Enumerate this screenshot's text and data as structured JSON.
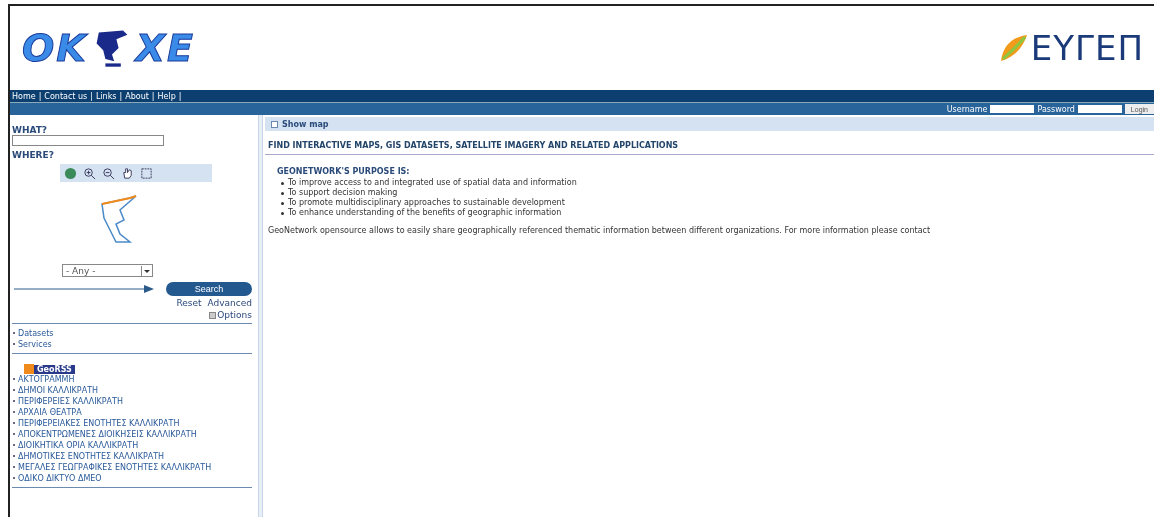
{
  "header": {
    "logo_left": [
      "OK",
      "XE"
    ],
    "logo_right": "ΕΥΓΕΠ"
  },
  "nav": {
    "links": [
      "Home",
      "Contact us",
      "Links",
      "About",
      "Help"
    ],
    "separator": "|"
  },
  "login": {
    "username_label": "Username",
    "password_label": "Password",
    "button": "Login"
  },
  "sidebar": {
    "what_label": "WHAT?",
    "where_label": "WHERE?",
    "region_select": "- Any -",
    "search_button": "Search",
    "reset": "Reset",
    "advanced": "Advanced",
    "options": "Options",
    "types": [
      "Datasets",
      "Services"
    ],
    "georss": "GeoRSS",
    "layers": [
      "ΑΚΤΟΓΡΑΜΜΗ",
      "ΔΗΜΟΙ ΚΑΛΛΙΚΡΑΤΗ",
      "ΠΕΡΙΦΕΡΕΙΕΣ ΚΑΛΛΙΚΡΑΤΗ",
      "ΑΡΧΑΙΑ ΘΕΑΤΡΑ",
      "ΠΕΡΙΦΕΡΕΙΑΚΕΣ ΕΝΟΤΗΤΕΣ ΚΑΛΛΙΚΡΑΤΗ",
      "ΑΠΟΚΕΝΤΡΩΜΕΝΕΣ ΔΙΟΙΚΗΣΕΙΣ ΚΑΛΛΙΚΡΑΤΗ",
      "ΔΙΟΙΚΗΤΙΚΑ ΟΡΙΑ ΚΑΛΛΙΚΡΑΤΗ",
      "ΔΗΜΟΤΙΚΕΣ ΕΝΟΤΗΤΕΣ ΚΑΛΛΙΚΡΑΤΗ",
      "ΜΕΓΑΛΕΣ ΓΕΩΓΡΑΦΙΚΕΣ ΕΝΟΤΗΤΕΣ ΚΑΛΛΙΚΡΑΤΗ",
      "ΟΔΙΚΟ ΔΙΚΤΥΟ ΔΜΕΟ"
    ]
  },
  "main": {
    "show_map": "Show map",
    "heading": "FIND INTERACTIVE MAPS, GIS DATASETS, SATELLITE IMAGERY AND RELATED APPLICATIONS",
    "purpose_title": "GEONETWORK'S PURPOSE IS:",
    "purposes": [
      "To improve access to and integrated use of spatial data and information",
      "To support decision making",
      "To promote multidisciplinary approaches to sustainable development",
      "To enhance understanding of the benefits of geographic information"
    ],
    "intro": "GeoNetwork opensource allows to easily share geographically referenced thematic information between different organizations. For more information please contact"
  }
}
